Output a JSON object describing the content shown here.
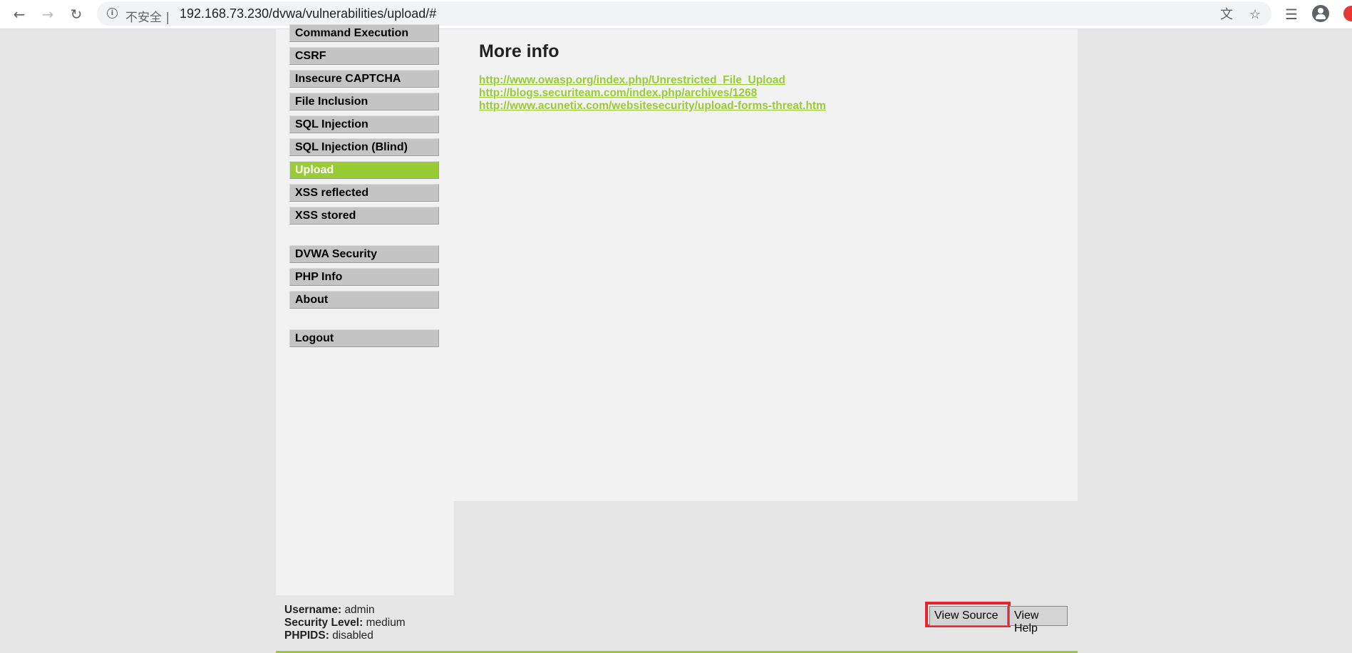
{
  "browser": {
    "insecure_label": "不安全 |",
    "url": "192.168.73.230/dvwa/vulnerabilities/upload/#",
    "icons": [
      "back-icon",
      "forward-icon",
      "reload-icon",
      "info-icon",
      "translate-icon",
      "star-icon",
      "reading-list-icon",
      "avatar-icon",
      "extension-icon"
    ]
  },
  "sidebar": {
    "items": [
      {
        "label": "Command Execution",
        "selected": false
      },
      {
        "label": "CSRF",
        "selected": false
      },
      {
        "label": "Insecure CAPTCHA",
        "selected": false
      },
      {
        "label": "File Inclusion",
        "selected": false
      },
      {
        "label": "SQL Injection",
        "selected": false
      },
      {
        "label": "SQL Injection (Blind)",
        "selected": false
      },
      {
        "label": "Upload",
        "selected": true
      },
      {
        "label": "XSS reflected",
        "selected": false
      },
      {
        "label": "XSS stored",
        "selected": false
      }
    ],
    "items2": [
      {
        "label": "DVWA Security"
      },
      {
        "label": "PHP Info"
      },
      {
        "label": "About"
      }
    ],
    "logout": "Logout"
  },
  "main": {
    "title": "More info",
    "links": [
      "http://www.owasp.org/index.php/Unrestricted_File_Upload",
      "http://blogs.securiteam.com/index.php/archives/1268",
      "http://www.acunetix.com/websitesecurity/upload-forms-threat.htm"
    ]
  },
  "footer": {
    "username_label": "Username:",
    "username": "admin",
    "security_label": "Security Level:",
    "security": "medium",
    "phpids_label": "PHPIDS:",
    "phpids": "disabled",
    "view_source": "View Source",
    "view_help": "View Help"
  },
  "colors": {
    "accent": "#99cc33",
    "highlight": "#e8252f"
  }
}
